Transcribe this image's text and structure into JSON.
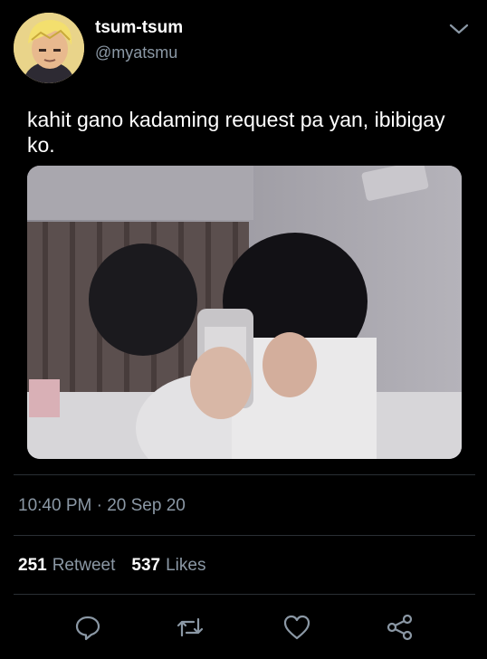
{
  "tweet": {
    "display_name": "tsum-tsum",
    "handle": "@myatsmu",
    "text": "kahit gano kadaming request pa yan, ibibigay ko.",
    "timestamp": "10:40 PM · 20 Sep 20",
    "retweets": {
      "count": "251",
      "label": "Retweet"
    },
    "likes": {
      "count": "537",
      "label": "Likes"
    }
  },
  "icons": {
    "menu": "chevron-down-icon",
    "reply": "reply-icon",
    "retweet": "retweet-icon",
    "like": "heart-icon",
    "share": "share-icon"
  },
  "colors": {
    "background": "#000000",
    "text": "#ffffff",
    "secondary_text": "#8b98a5",
    "divider": "#2a2f34"
  }
}
